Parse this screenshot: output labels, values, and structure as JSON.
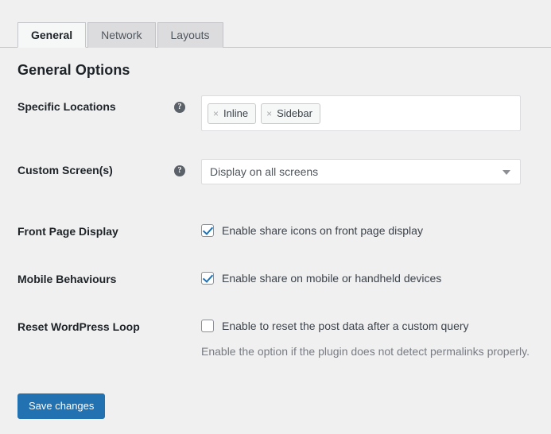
{
  "tabs": [
    {
      "label": "General",
      "active": true
    },
    {
      "label": "Network",
      "active": false
    },
    {
      "label": "Layouts",
      "active": false
    }
  ],
  "page": {
    "title": "General Options"
  },
  "icons": {
    "help": "?",
    "chip_remove": "×"
  },
  "rows": {
    "specific_locations": {
      "label": "Specific Locations",
      "chips": [
        {
          "label": "Inline"
        },
        {
          "label": "Sidebar"
        }
      ]
    },
    "custom_screens": {
      "label": "Custom Screen(s)",
      "selected": "Display on all screens"
    },
    "front_page_display": {
      "label": "Front Page Display",
      "checkbox_label": "Enable share icons on front page display",
      "checked": true
    },
    "mobile_behaviours": {
      "label": "Mobile Behaviours",
      "checkbox_label": "Enable share on mobile or handheld devices",
      "checked": true
    },
    "reset_wordpress_loop": {
      "label": "Reset WordPress Loop",
      "checkbox_label": "Enable to reset the post data after a custom query",
      "checked": false,
      "helper_text": "Enable the option if the plugin does not detect permalinks properly."
    }
  },
  "footer": {
    "save_label": "Save changes"
  },
  "colors": {
    "accent": "#2271b1",
    "page_background": "#f0f0f1",
    "border": "#c3c4c7",
    "tab_inactive": "#dcdcde",
    "text_primary": "#1d2327",
    "text_muted": "#787c82"
  }
}
